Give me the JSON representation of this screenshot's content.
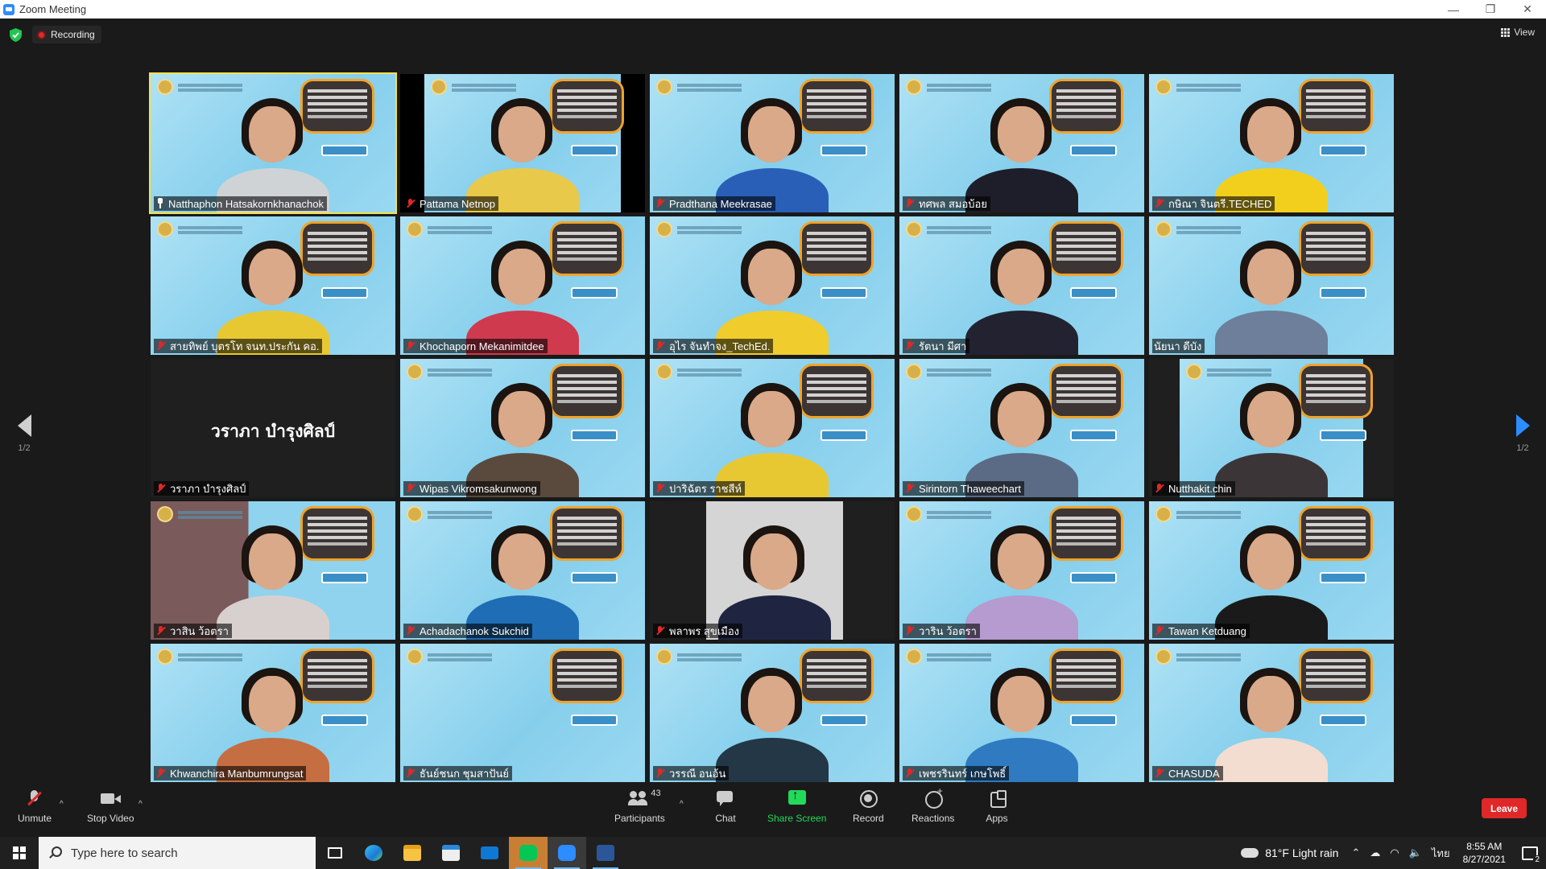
{
  "window": {
    "title": "Zoom Meeting",
    "controls": {
      "minimize": "—",
      "restore": "❐",
      "close": "✕"
    }
  },
  "meeting_top": {
    "recording_label": "Recording",
    "view_label": "View"
  },
  "pagination": {
    "left_page": "1/2",
    "right_page": "1/2"
  },
  "participants": [
    {
      "name": "Natthaphon Hatsakornkhanachok",
      "style": "background",
      "shirt": "#cfd3d6",
      "status": "pin",
      "active": true
    },
    {
      "name": "Pattama Netnop",
      "style": "background-black",
      "shirt": "#e9c94a",
      "status": "muted",
      "active": false
    },
    {
      "name": "Pradthana Meekrasae",
      "style": "background",
      "shirt": "#2a5fb8",
      "status": "muted",
      "active": false
    },
    {
      "name": "ทศพล สมอบ้อย",
      "style": "background",
      "shirt": "#1e1e2a",
      "status": "muted",
      "active": false
    },
    {
      "name": "กษิณา จินตรี.TECHED",
      "style": "background",
      "shirt": "#f2cf1d",
      "status": "muted",
      "active": false
    },
    {
      "name": "สายทิพย์ บุตรโท จนท.ประกัน คอ.",
      "style": "background",
      "shirt": "#e8c832",
      "status": "muted",
      "active": false
    },
    {
      "name": "Khochaporn Mekanimitdee",
      "style": "background",
      "shirt": "#cf3a4e",
      "status": "muted",
      "active": false
    },
    {
      "name": "อุไร จันทำจง_TechEd.",
      "style": "background",
      "shirt": "#f0cc2c",
      "status": "muted",
      "active": false
    },
    {
      "name": "รัตนา มีศา",
      "style": "background",
      "shirt": "#222230",
      "status": "muted",
      "active": false
    },
    {
      "name": "นัยนา ดีบัง",
      "style": "background",
      "shirt": "#6d7f9a",
      "status": "none",
      "active": false
    },
    {
      "name": "วราภา บำรุงศิลป์",
      "style": "no-video",
      "shirt": "",
      "status": "muted",
      "active": false,
      "center_text": "วราภา บำรุงศิลป์"
    },
    {
      "name": "Wipas Vikromsakunwong",
      "style": "background",
      "shirt": "#5a4a3d",
      "status": "muted",
      "active": false
    },
    {
      "name": "ปาริฉัตร ราชสีห์",
      "style": "background",
      "shirt": "#e8c832",
      "status": "muted",
      "active": false
    },
    {
      "name": "Sirintorn Thaweechart",
      "style": "background",
      "shirt": "#5b6b85",
      "status": "muted",
      "active": false
    },
    {
      "name": "Nutthakit.chin",
      "style": "background-narrow",
      "shirt": "#3c3538",
      "status": "muted",
      "active": false
    },
    {
      "name": "วาสิน ว้อตรา",
      "style": "background-room",
      "shirt": "#d8d0cf",
      "status": "muted",
      "active": false
    },
    {
      "name": "Achadachanok Sukchid",
      "style": "background",
      "shirt": "#1f6db5",
      "status": "muted",
      "active": false
    },
    {
      "name": "พลาพร สุขเมือง",
      "style": "photo",
      "shirt": "#1f2540",
      "status": "muted",
      "active": false
    },
    {
      "name": "วาริน ว้อตรา",
      "style": "background",
      "shirt": "#b59bd0",
      "status": "muted",
      "active": false
    },
    {
      "name": "Tawan Ketduang",
      "style": "background",
      "shirt": "#1a1a1a",
      "status": "muted",
      "active": false
    },
    {
      "name": "Khwanchira Manbumrungsat",
      "style": "background",
      "shirt": "#c56e42",
      "status": "muted",
      "active": false
    },
    {
      "name": "ธันย์ชนก ชุมสาปันย์",
      "style": "background-empty",
      "shirt": "",
      "status": "muted",
      "active": false
    },
    {
      "name": "วรรณี อนอ้น",
      "style": "background",
      "shirt": "#233746",
      "status": "muted",
      "active": false
    },
    {
      "name": "เพชรรินทร์ เกษโพธิ์",
      "style": "background",
      "shirt": "#2f7ac0",
      "status": "muted",
      "active": false
    },
    {
      "name": "CHASUDA",
      "style": "background",
      "shirt": "#f3ddd0",
      "status": "muted",
      "active": false
    }
  ],
  "toolbar": {
    "unmute_label": "Unmute",
    "stop_video_label": "Stop Video",
    "participants_label": "Participants",
    "participants_count": "43",
    "chat_label": "Chat",
    "share_screen_label": "Share Screen",
    "record_label": "Record",
    "reactions_label": "Reactions",
    "apps_label": "Apps",
    "leave_label": "Leave",
    "caret": "^",
    "share_color": "#23d959",
    "leave_color": "#e02828"
  },
  "taskbar": {
    "search_placeholder": "Type here to search",
    "apps": [
      "task-view",
      "edge",
      "file-explorer",
      "microsoft-store",
      "mail",
      "line",
      "zoom",
      "word"
    ],
    "weather": "81°F  Light rain",
    "language": "ไทย",
    "time": "8:55 AM",
    "date": "8/27/2021",
    "notification_count": "2"
  }
}
